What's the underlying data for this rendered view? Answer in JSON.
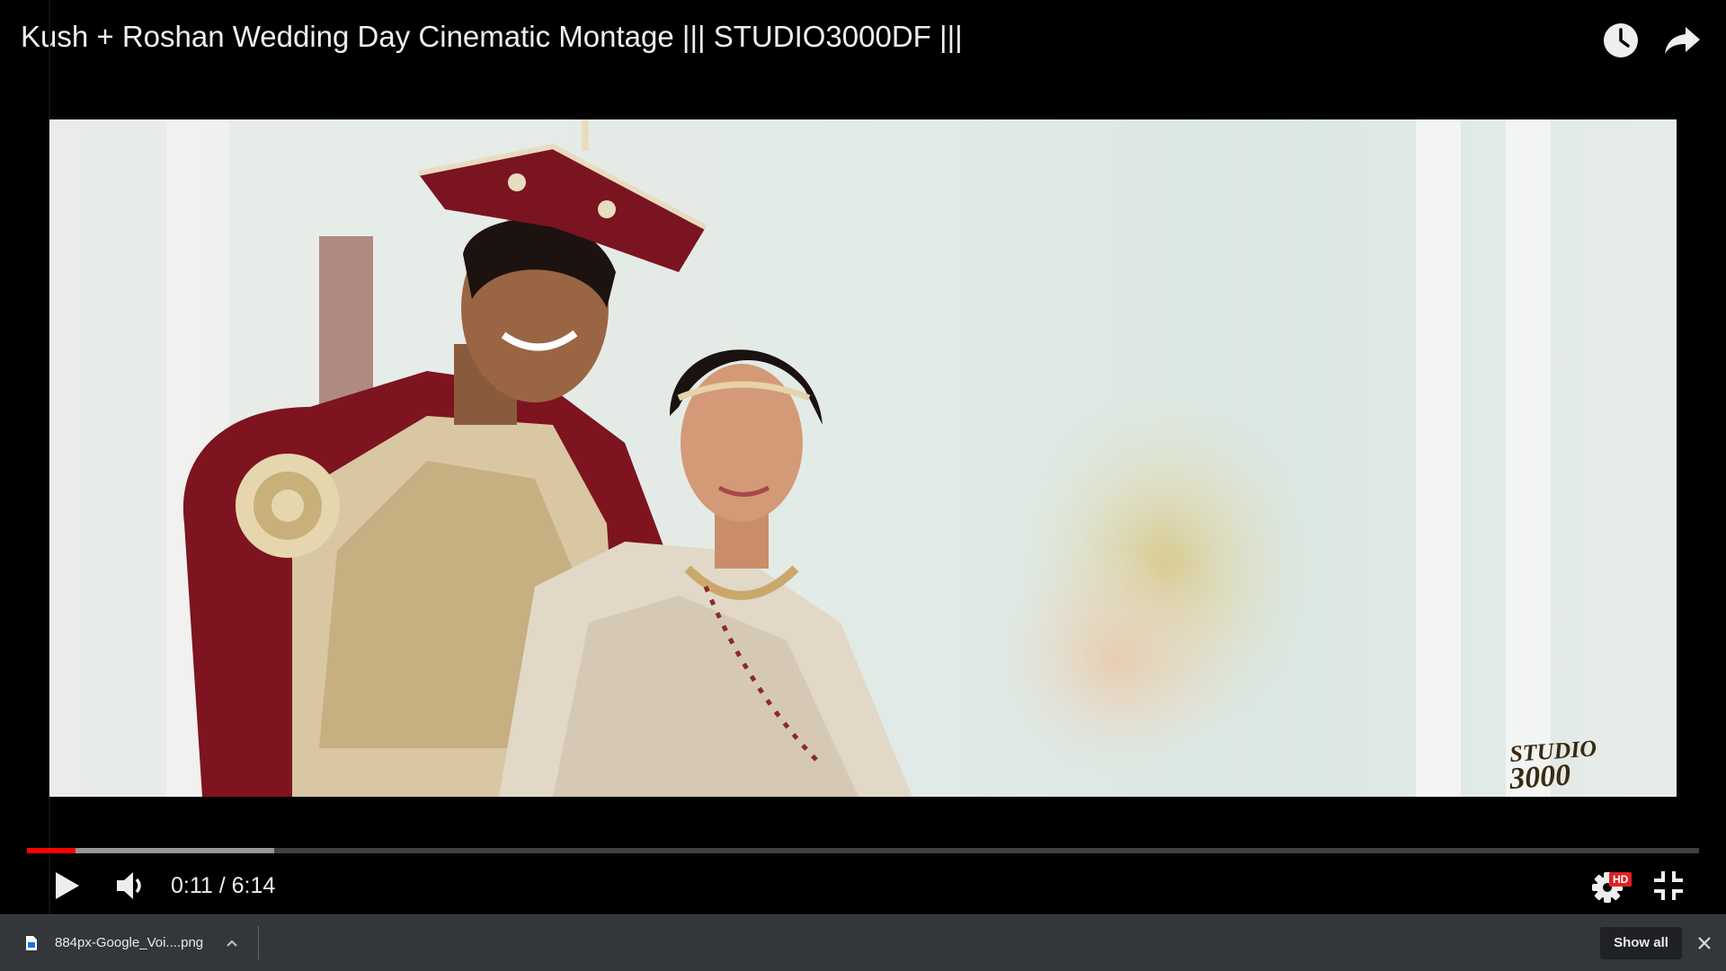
{
  "video": {
    "title": "Kush + Roshan Wedding Day Cinematic Montage ||| STUDIO3000DF |||",
    "watermark_line1": "STUDIO",
    "watermark_line2": "3000"
  },
  "player": {
    "current_time": "0:11",
    "separator": " / ",
    "duration": "6:14",
    "played_fraction": 0.029,
    "buffered_fraction": 0.148,
    "quality_badge": "HD",
    "accent_color": "#ff0000"
  },
  "top_actions": {
    "watch_later_icon": "clock-icon",
    "share_icon": "share-arrow-icon"
  },
  "downloads": {
    "file_name": "884px-Google_Voi....png",
    "show_all_label": "Show all"
  }
}
